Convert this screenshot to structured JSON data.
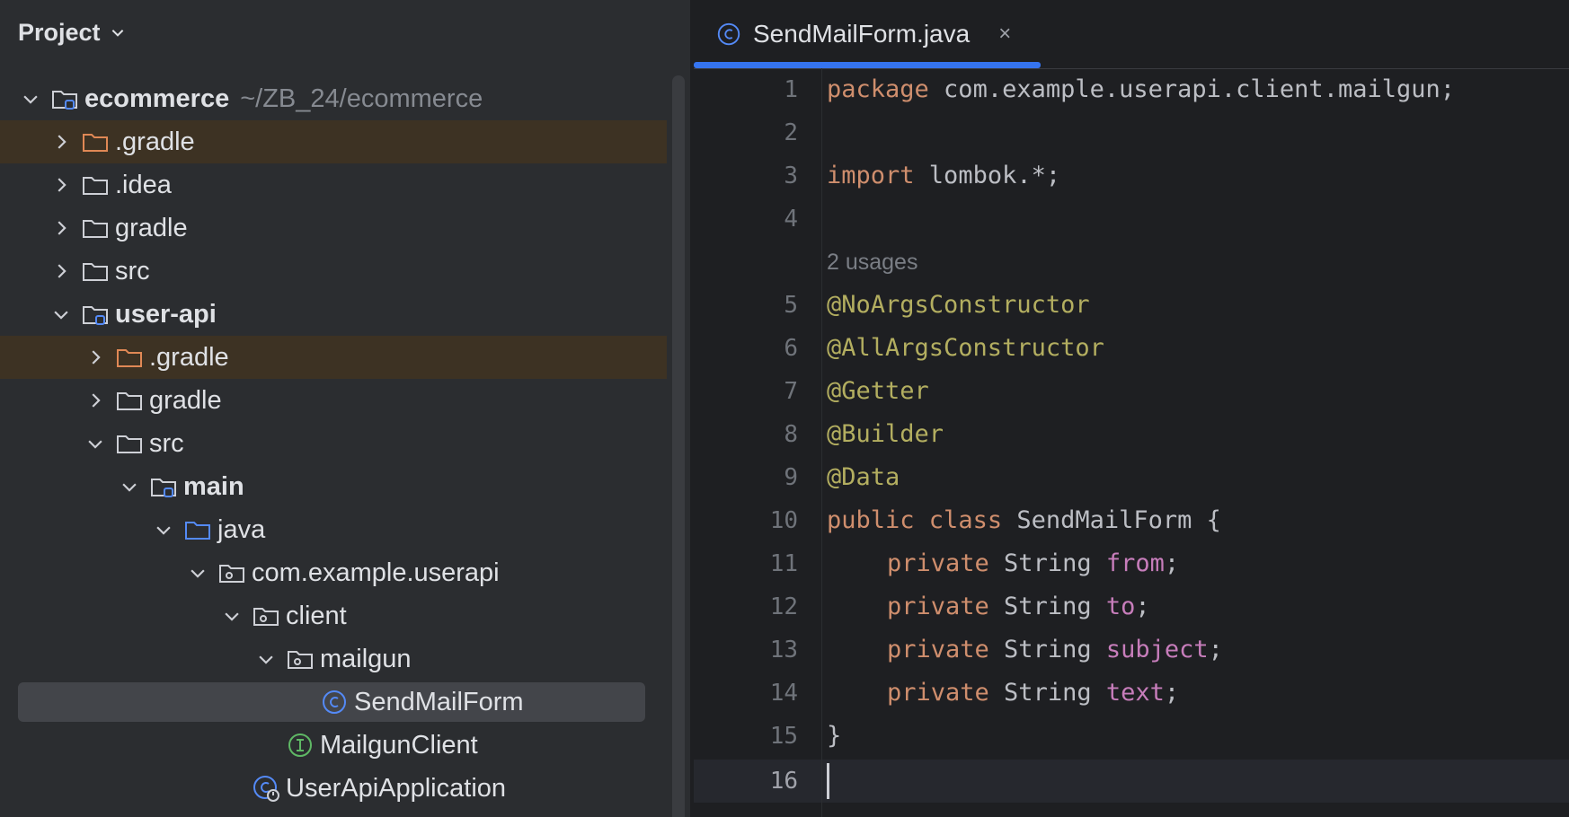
{
  "panel": {
    "title": "Project"
  },
  "tree": [
    {
      "label": "ecommerce",
      "hint": "~/ZB_24/ecommerce"
    },
    {
      "label": ".gradle"
    },
    {
      "label": ".idea"
    },
    {
      "label": "gradle"
    },
    {
      "label": "src"
    },
    {
      "label": "user-api"
    },
    {
      "label": ".gradle"
    },
    {
      "label": "gradle"
    },
    {
      "label": "src"
    },
    {
      "label": "main"
    },
    {
      "label": "java"
    },
    {
      "label": "com.example.userapi"
    },
    {
      "label": "client"
    },
    {
      "label": "mailgun"
    },
    {
      "label": "SendMailForm"
    },
    {
      "label": "MailgunClient"
    },
    {
      "label": "UserApiApplication"
    }
  ],
  "editor": {
    "tab_title": "SendMailForm.java",
    "close_glyph": "×",
    "line_numbers": [
      "1",
      "2",
      "3",
      "4",
      "5",
      "6",
      "7",
      "8",
      "9",
      "10",
      "11",
      "12",
      "13",
      "14",
      "15",
      "16"
    ],
    "usage_hint": "2 usages",
    "code": {
      "l1_kw": "package",
      "l1_rest": " com.example.userapi.client.mailgun;",
      "l3_kw": "import",
      "l3_rest": " lombok.*;",
      "l5": "@NoArgsConstructor",
      "l6": "@AllArgsConstructor",
      "l7": "@Getter",
      "l8": "@Builder",
      "l9": "@Data",
      "l10_kw1": "public",
      "l10_kw2": " class",
      "l10_rest": " SendMailForm {",
      "private_kw": "private",
      "string_type": " String ",
      "f_from": "from",
      "f_to": "to",
      "f_subject": "subject",
      "f_text": "text",
      "semi": ";",
      "l15": "}"
    }
  },
  "colors": {
    "keyword": "#cf8e6d",
    "annotation": "#b3ae60",
    "field": "#c77dbb",
    "accent": "#3574f0",
    "excluded_bg": "#3d3223",
    "selected_bg": "#43454a"
  }
}
